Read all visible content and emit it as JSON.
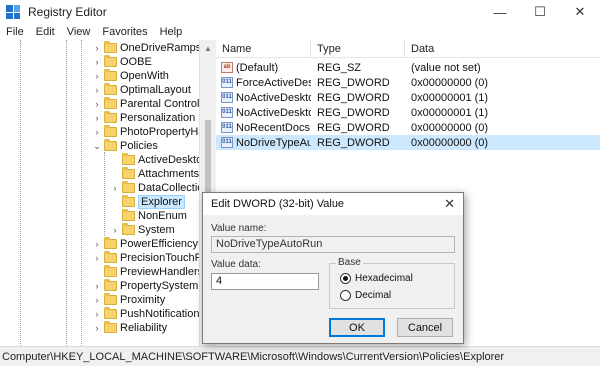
{
  "window": {
    "title": "Registry Editor",
    "minimize": "—",
    "maximize": "☐",
    "close": "✕"
  },
  "menu": [
    "File",
    "Edit",
    "View",
    "Favorites",
    "Help"
  ],
  "tree": {
    "items": [
      {
        "label": "OneDriveRamps",
        "expander": "›"
      },
      {
        "label": "OOBE",
        "expander": "›"
      },
      {
        "label": "OpenWith",
        "expander": "›"
      },
      {
        "label": "OptimalLayout",
        "expander": "›"
      },
      {
        "label": "Parental Controls",
        "expander": "›"
      },
      {
        "label": "Personalization",
        "expander": "›"
      },
      {
        "label": "PhotoPropertyHar",
        "expander": "›"
      },
      {
        "label": "Policies",
        "expander": "⌄"
      },
      {
        "label": "ActiveDesktop",
        "expander": ""
      },
      {
        "label": "Attachments",
        "expander": ""
      },
      {
        "label": "DataCollection",
        "expander": "›"
      },
      {
        "label": "Explorer",
        "expander": ""
      },
      {
        "label": "NonEnum",
        "expander": ""
      },
      {
        "label": "System",
        "expander": "›"
      },
      {
        "label": "PowerEfficiencyDi",
        "expander": "›"
      },
      {
        "label": "PrecisionTouchPac",
        "expander": "›"
      },
      {
        "label": "PreviewHandlers",
        "expander": ""
      },
      {
        "label": "PropertySystem",
        "expander": "›"
      },
      {
        "label": "Proximity",
        "expander": "›"
      },
      {
        "label": "PushNotifications",
        "expander": "›"
      },
      {
        "label": "Reliability",
        "expander": "›"
      }
    ]
  },
  "list": {
    "headers": {
      "name": "Name",
      "type": "Type",
      "data": "Data"
    },
    "rows": [
      {
        "name": "(Default)",
        "type": "REG_SZ",
        "data": "(value not set)",
        "icon": "ab"
      },
      {
        "name": "ForceActiveDes...",
        "type": "REG_DWORD",
        "data": "0x00000000 (0)",
        "icon": "011"
      },
      {
        "name": "NoActiveDesktop",
        "type": "REG_DWORD",
        "data": "0x00000001 (1)",
        "icon": "011"
      },
      {
        "name": "NoActiveDeskto...",
        "type": "REG_DWORD",
        "data": "0x00000001 (1)",
        "icon": "011"
      },
      {
        "name": "NoRecentDocs...",
        "type": "REG_DWORD",
        "data": "0x00000000 (0)",
        "icon": "011"
      },
      {
        "name": "NoDriveTypeAu...",
        "type": "REG_DWORD",
        "data": "0x00000000 (0)",
        "icon": "011"
      }
    ]
  },
  "status": {
    "path": "Computer\\HKEY_LOCAL_MACHINE\\SOFTWARE\\Microsoft\\Windows\\CurrentVersion\\Policies\\Explorer"
  },
  "dialog": {
    "title": "Edit DWORD (32-bit) Value",
    "close": "✕",
    "value_name_label": "Value name:",
    "value_name": "NoDriveTypeAutoRun",
    "value_data_label": "Value data:",
    "value_data": "4",
    "base_label": "Base",
    "hex_label": "Hexadecimal",
    "dec_label": "Decimal",
    "selected_base": "Hexadecimal",
    "ok_label": "OK",
    "cancel_label": "Cancel"
  }
}
